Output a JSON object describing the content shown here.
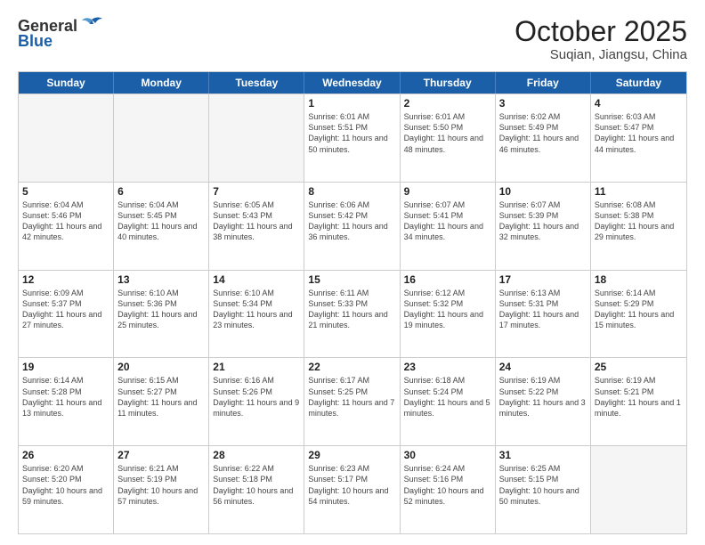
{
  "header": {
    "logo_general": "General",
    "logo_blue": "Blue",
    "month_title": "October 2025",
    "location": "Suqian, Jiangsu, China"
  },
  "weekdays": [
    "Sunday",
    "Monday",
    "Tuesday",
    "Wednesday",
    "Thursday",
    "Friday",
    "Saturday"
  ],
  "rows": [
    [
      {
        "day": "",
        "info": ""
      },
      {
        "day": "",
        "info": ""
      },
      {
        "day": "",
        "info": ""
      },
      {
        "day": "1",
        "info": "Sunrise: 6:01 AM\nSunset: 5:51 PM\nDaylight: 11 hours and 50 minutes."
      },
      {
        "day": "2",
        "info": "Sunrise: 6:01 AM\nSunset: 5:50 PM\nDaylight: 11 hours and 48 minutes."
      },
      {
        "day": "3",
        "info": "Sunrise: 6:02 AM\nSunset: 5:49 PM\nDaylight: 11 hours and 46 minutes."
      },
      {
        "day": "4",
        "info": "Sunrise: 6:03 AM\nSunset: 5:47 PM\nDaylight: 11 hours and 44 minutes."
      }
    ],
    [
      {
        "day": "5",
        "info": "Sunrise: 6:04 AM\nSunset: 5:46 PM\nDaylight: 11 hours and 42 minutes."
      },
      {
        "day": "6",
        "info": "Sunrise: 6:04 AM\nSunset: 5:45 PM\nDaylight: 11 hours and 40 minutes."
      },
      {
        "day": "7",
        "info": "Sunrise: 6:05 AM\nSunset: 5:43 PM\nDaylight: 11 hours and 38 minutes."
      },
      {
        "day": "8",
        "info": "Sunrise: 6:06 AM\nSunset: 5:42 PM\nDaylight: 11 hours and 36 minutes."
      },
      {
        "day": "9",
        "info": "Sunrise: 6:07 AM\nSunset: 5:41 PM\nDaylight: 11 hours and 34 minutes."
      },
      {
        "day": "10",
        "info": "Sunrise: 6:07 AM\nSunset: 5:39 PM\nDaylight: 11 hours and 32 minutes."
      },
      {
        "day": "11",
        "info": "Sunrise: 6:08 AM\nSunset: 5:38 PM\nDaylight: 11 hours and 29 minutes."
      }
    ],
    [
      {
        "day": "12",
        "info": "Sunrise: 6:09 AM\nSunset: 5:37 PM\nDaylight: 11 hours and 27 minutes."
      },
      {
        "day": "13",
        "info": "Sunrise: 6:10 AM\nSunset: 5:36 PM\nDaylight: 11 hours and 25 minutes."
      },
      {
        "day": "14",
        "info": "Sunrise: 6:10 AM\nSunset: 5:34 PM\nDaylight: 11 hours and 23 minutes."
      },
      {
        "day": "15",
        "info": "Sunrise: 6:11 AM\nSunset: 5:33 PM\nDaylight: 11 hours and 21 minutes."
      },
      {
        "day": "16",
        "info": "Sunrise: 6:12 AM\nSunset: 5:32 PM\nDaylight: 11 hours and 19 minutes."
      },
      {
        "day": "17",
        "info": "Sunrise: 6:13 AM\nSunset: 5:31 PM\nDaylight: 11 hours and 17 minutes."
      },
      {
        "day": "18",
        "info": "Sunrise: 6:14 AM\nSunset: 5:29 PM\nDaylight: 11 hours and 15 minutes."
      }
    ],
    [
      {
        "day": "19",
        "info": "Sunrise: 6:14 AM\nSunset: 5:28 PM\nDaylight: 11 hours and 13 minutes."
      },
      {
        "day": "20",
        "info": "Sunrise: 6:15 AM\nSunset: 5:27 PM\nDaylight: 11 hours and 11 minutes."
      },
      {
        "day": "21",
        "info": "Sunrise: 6:16 AM\nSunset: 5:26 PM\nDaylight: 11 hours and 9 minutes."
      },
      {
        "day": "22",
        "info": "Sunrise: 6:17 AM\nSunset: 5:25 PM\nDaylight: 11 hours and 7 minutes."
      },
      {
        "day": "23",
        "info": "Sunrise: 6:18 AM\nSunset: 5:24 PM\nDaylight: 11 hours and 5 minutes."
      },
      {
        "day": "24",
        "info": "Sunrise: 6:19 AM\nSunset: 5:22 PM\nDaylight: 11 hours and 3 minutes."
      },
      {
        "day": "25",
        "info": "Sunrise: 6:19 AM\nSunset: 5:21 PM\nDaylight: 11 hours and 1 minute."
      }
    ],
    [
      {
        "day": "26",
        "info": "Sunrise: 6:20 AM\nSunset: 5:20 PM\nDaylight: 10 hours and 59 minutes."
      },
      {
        "day": "27",
        "info": "Sunrise: 6:21 AM\nSunset: 5:19 PM\nDaylight: 10 hours and 57 minutes."
      },
      {
        "day": "28",
        "info": "Sunrise: 6:22 AM\nSunset: 5:18 PM\nDaylight: 10 hours and 56 minutes."
      },
      {
        "day": "29",
        "info": "Sunrise: 6:23 AM\nSunset: 5:17 PM\nDaylight: 10 hours and 54 minutes."
      },
      {
        "day": "30",
        "info": "Sunrise: 6:24 AM\nSunset: 5:16 PM\nDaylight: 10 hours and 52 minutes."
      },
      {
        "day": "31",
        "info": "Sunrise: 6:25 AM\nSunset: 5:15 PM\nDaylight: 10 hours and 50 minutes."
      },
      {
        "day": "",
        "info": ""
      }
    ]
  ]
}
